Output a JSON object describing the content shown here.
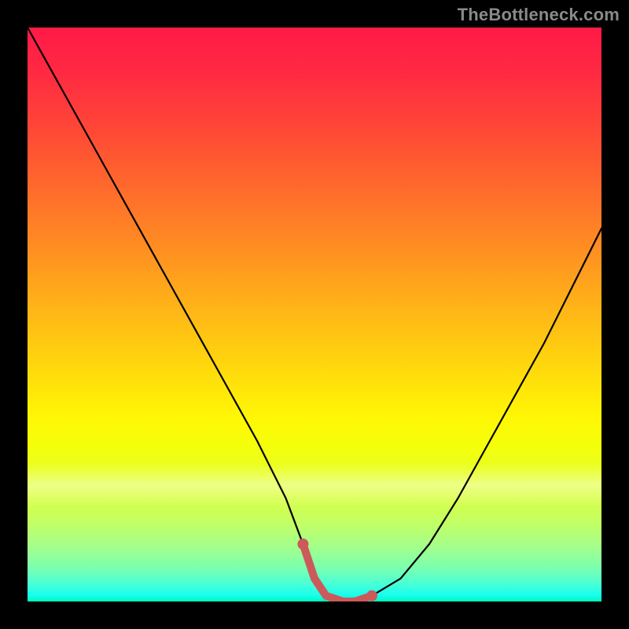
{
  "watermark": {
    "text": "TheBottleneck.com"
  },
  "chart_data": {
    "type": "line",
    "title": "",
    "xlabel": "",
    "ylabel": "",
    "xlim": [
      0,
      100
    ],
    "ylim": [
      0,
      100
    ],
    "grid": false,
    "series": [
      {
        "name": "curve",
        "x": [
          0,
          5,
          10,
          15,
          20,
          25,
          30,
          35,
          40,
          45,
          48,
          50,
          52,
          55,
          57,
          60,
          65,
          70,
          75,
          80,
          85,
          90,
          95,
          100
        ],
        "values": [
          100,
          91,
          82,
          73,
          64,
          55,
          46,
          37,
          28,
          18,
          10,
          4,
          1,
          0,
          0,
          1,
          4,
          10,
          18,
          27,
          36,
          45,
          55,
          65
        ]
      },
      {
        "name": "highlight",
        "x": [
          48,
          50,
          52,
          55,
          57,
          60
        ],
        "values": [
          10,
          4,
          1,
          0,
          0,
          1
        ]
      }
    ],
    "colors": {
      "curve": "#000000",
      "highlight": "#cc5a5a",
      "gradient_top": "#ff1947",
      "gradient_mid": "#fff704",
      "gradient_bottom": "#00f7b9"
    }
  }
}
